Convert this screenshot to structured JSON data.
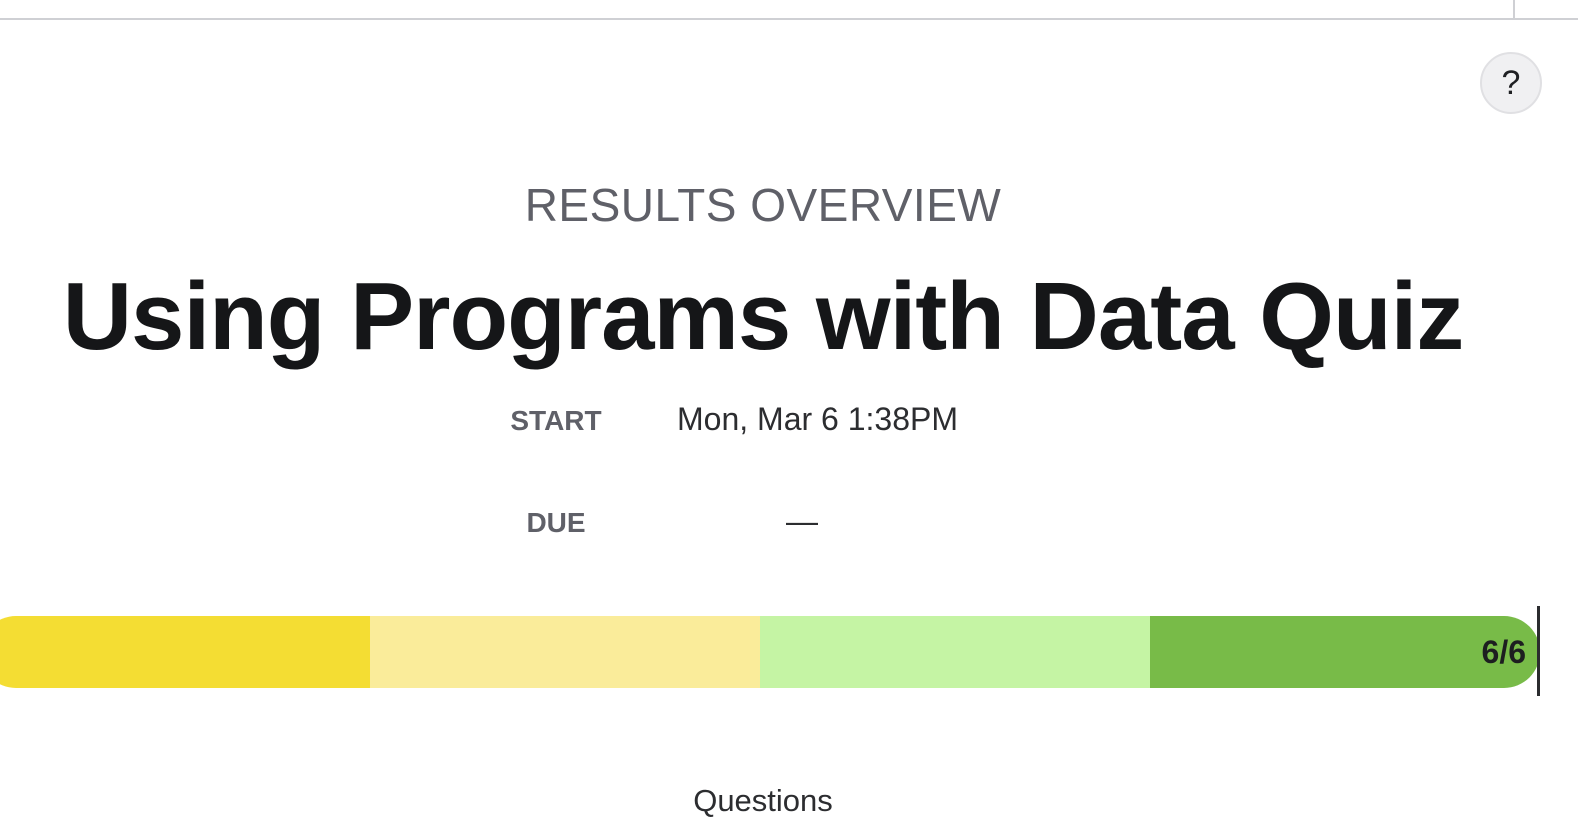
{
  "help": {
    "label": "?"
  },
  "header": {
    "overview_label": "RESULTS OVERVIEW",
    "title": "Using Programs with Data Quiz"
  },
  "meta": {
    "start_label": "START",
    "start_value": "Mon, Mar 6 1:38PM",
    "due_label": "DUE",
    "due_value": "—"
  },
  "progress": {
    "score": "6/6",
    "segments": [
      {
        "color": "#f4dd33"
      },
      {
        "color": "#faec9a"
      },
      {
        "color": "#c5f4a4"
      },
      {
        "color": "#78bb48"
      }
    ]
  },
  "questions": {
    "heading": "Questions"
  }
}
